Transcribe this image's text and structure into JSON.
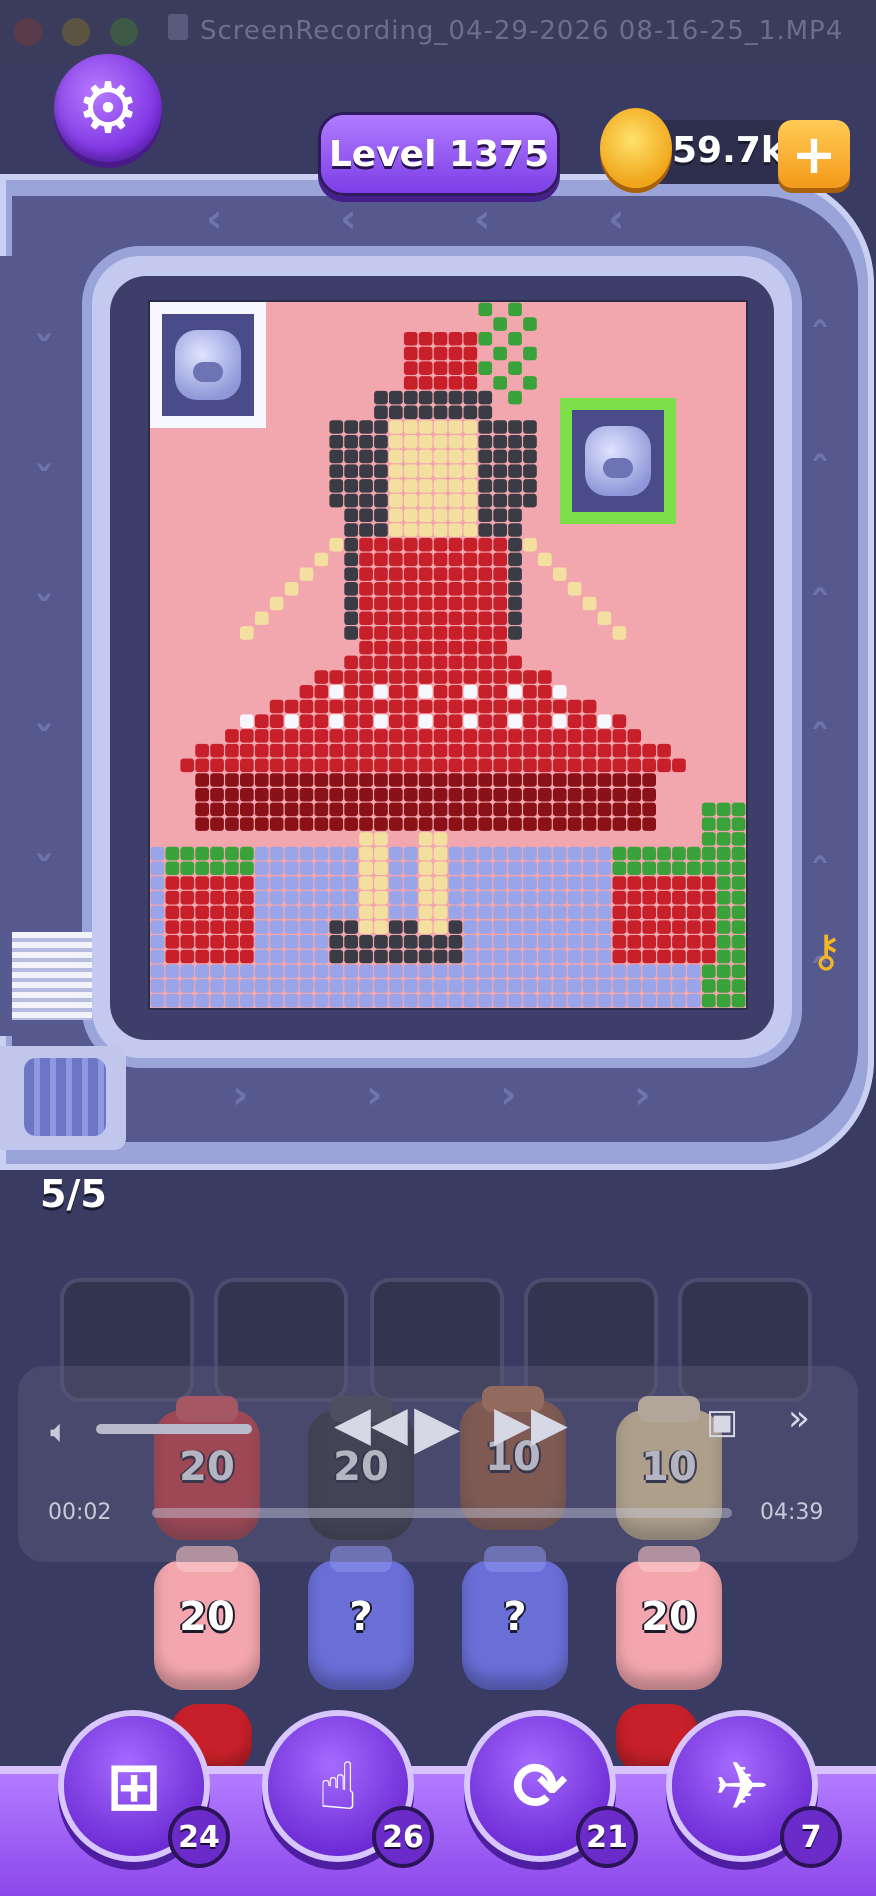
{
  "window": {
    "title": "ScreenRecording_04-29-2026 08-16-25_1.MP4",
    "traffic_colors": [
      "#5a3b4a",
      "#5a5440",
      "#3e5a44"
    ]
  },
  "hud": {
    "settings_icon": "gear-icon",
    "level_label": "Level 1375",
    "coins": "59.7k",
    "add_coins_icon": "plus-icon"
  },
  "conveyor": {
    "capacity": "5/5"
  },
  "board": {
    "palette": {
      "P": "#f2a6ad",
      "R": "#c8202a",
      "D": "#8a1117",
      "K": "#3a3b44",
      "Y": "#f3e0a0",
      "G": "#3aa23a",
      "L": "#9aa4e8",
      "W": "#f7f7ff",
      "S": "#f7d8c4"
    },
    "key_icon": "key-icon",
    "pigs": [
      "pig-icon",
      "pig-icon"
    ]
  },
  "queue": {
    "slot_count": 5
  },
  "media": {
    "elapsed": "00:02",
    "duration": "04:39",
    "volume_icon": "speaker-icon",
    "rewind_icon": "rewind-icon",
    "play_icon": "play-icon",
    "forward_icon": "fast-forward-icon",
    "pip_icon": "picture-in-picture-icon",
    "skip_icon": "skip-icon"
  },
  "shooters": {
    "row1": [
      {
        "count": "20",
        "color": "#d63a3a"
      },
      {
        "count": "20",
        "color": "#2f3038"
      },
      {
        "count": "10",
        "color": "#9b5a36"
      },
      {
        "count": "10",
        "color": "#f0d79a"
      }
    ],
    "row2": [
      {
        "count": "20",
        "color": "#f3a6ae"
      },
      {
        "count": "?",
        "color": "#6a6fd8"
      },
      {
        "count": "?",
        "color": "#6a6fd8"
      },
      {
        "count": "20",
        "color": "#f3a6ae"
      }
    ]
  },
  "powerups": [
    {
      "name": "add-slot",
      "icon": "add-card-icon",
      "count": "24"
    },
    {
      "name": "hand",
      "icon": "hand-pointer-icon",
      "count": "26"
    },
    {
      "name": "shuffle",
      "icon": "refresh-icon",
      "count": "21"
    },
    {
      "name": "vacuum",
      "icon": "pig-vacuum-icon",
      "count": "7"
    }
  ]
}
